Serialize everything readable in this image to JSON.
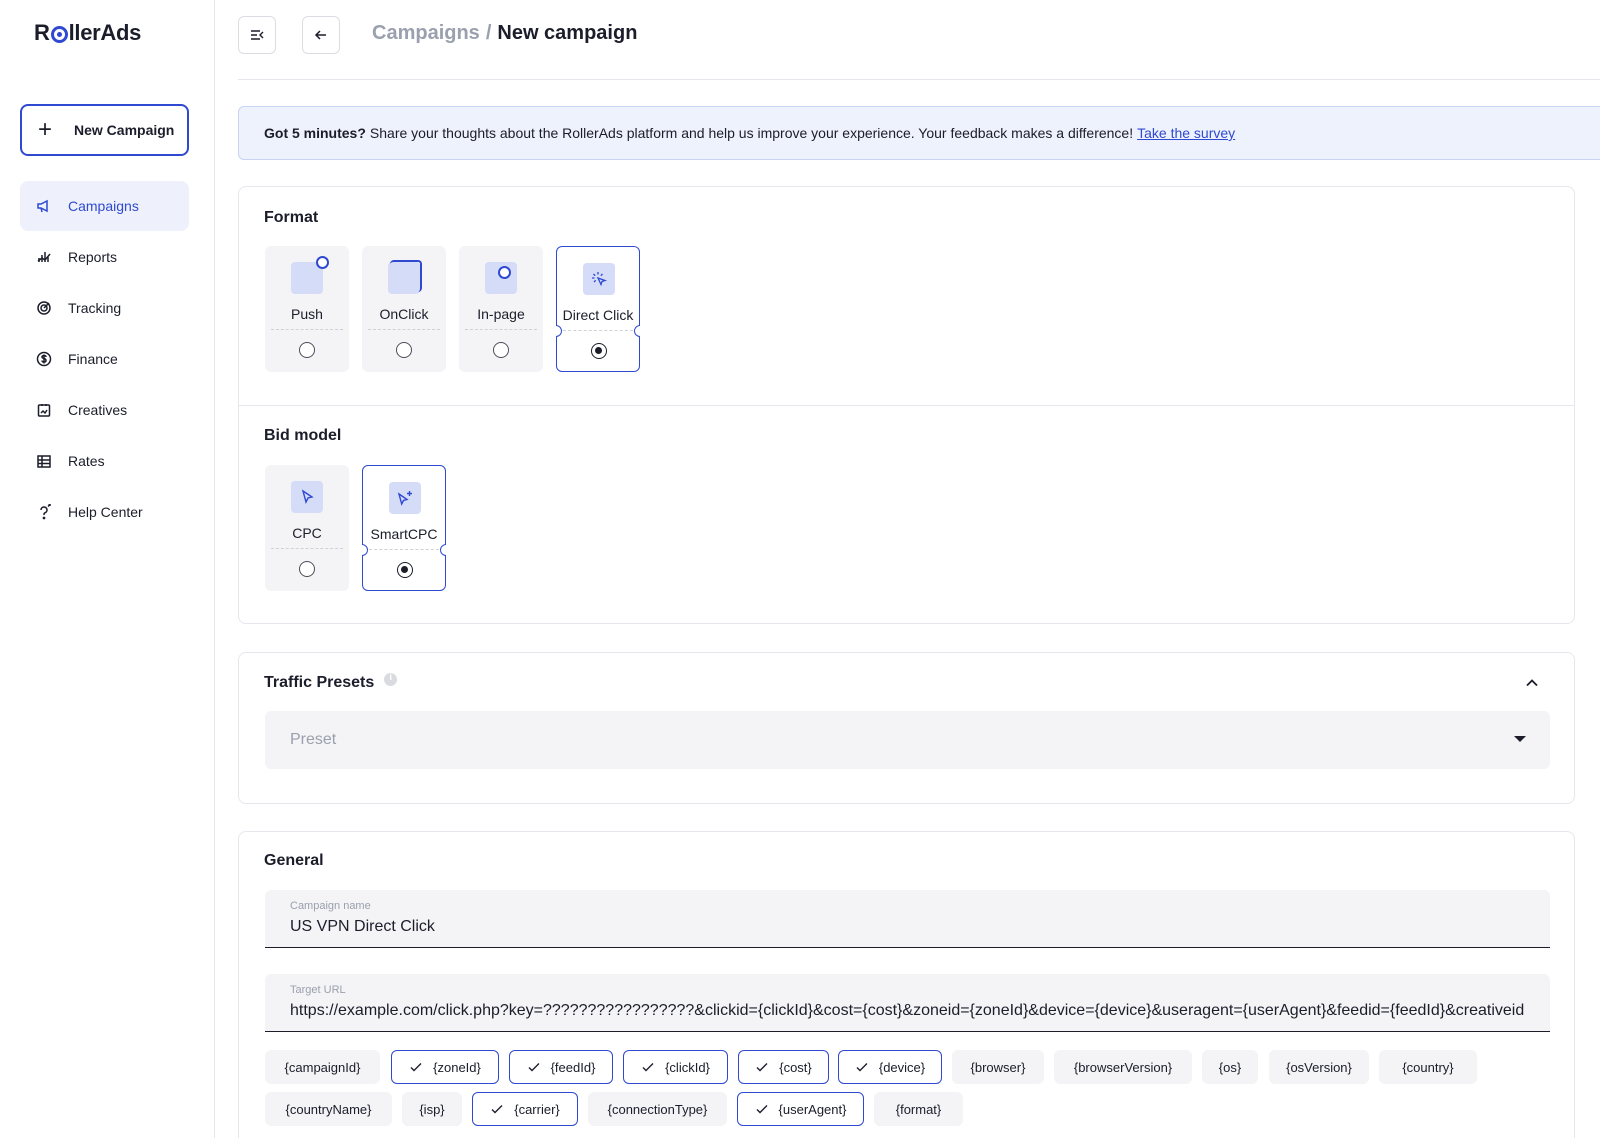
{
  "app": {
    "logo_text_before": "R",
    "logo_text_after": "llerAds",
    "accent_color": "#2f49d1"
  },
  "sidebar": {
    "new_campaign_label": "New Campaign",
    "items": [
      {
        "label": "Campaigns",
        "icon": "megaphone-icon",
        "active": true
      },
      {
        "label": "Reports",
        "icon": "chart-icon",
        "active": false
      },
      {
        "label": "Tracking",
        "icon": "target-icon",
        "active": false
      },
      {
        "label": "Finance",
        "icon": "dollar-icon",
        "active": false
      },
      {
        "label": "Creatives",
        "icon": "image-icon",
        "active": false
      },
      {
        "label": "Rates",
        "icon": "table-icon",
        "active": false
      },
      {
        "label": "Help Center",
        "icon": "help-icon",
        "active": false
      }
    ]
  },
  "header": {
    "breadcrumb_parent": "Campaigns",
    "breadcrumb_separator": "/",
    "breadcrumb_current": "New campaign"
  },
  "banner": {
    "bold": "Got 5 minutes?",
    "text": "Share your thoughts about the RollerAds platform and help us improve your experience. Your feedback makes a difference!",
    "link": "Take the survey"
  },
  "format": {
    "title": "Format",
    "options": [
      {
        "label": "Push",
        "selected": false
      },
      {
        "label": "OnClick",
        "selected": false
      },
      {
        "label": "In-page",
        "selected": false
      },
      {
        "label": "Direct Click",
        "selected": true
      }
    ]
  },
  "bid_model": {
    "title": "Bid model",
    "options": [
      {
        "label": "CPC",
        "selected": false
      },
      {
        "label": "SmartCPC",
        "selected": true
      }
    ]
  },
  "traffic_presets": {
    "title": "Traffic Presets",
    "placeholder": "Preset"
  },
  "general": {
    "title": "General",
    "campaign_name_label": "Campaign name",
    "campaign_name_value": "US VPN Direct Click",
    "target_url_label": "Target URL",
    "target_url_value": "https://example.com/click.php?key=?????????????????&clickid={clickId}&cost={cost}&zoneid={zoneId}&device={device}&useragent={userAgent}&feedid={feedId}&creativeid={",
    "macros": [
      {
        "label": "{campaignId}",
        "on": false
      },
      {
        "label": "{zoneId}",
        "on": true
      },
      {
        "label": "{feedId}",
        "on": true
      },
      {
        "label": "{clickId}",
        "on": true
      },
      {
        "label": "{cost}",
        "on": true
      },
      {
        "label": "{device}",
        "on": true
      },
      {
        "label": "{browser}",
        "on": false
      },
      {
        "label": "{browserVersion}",
        "on": false
      },
      {
        "label": "{os}",
        "on": false
      },
      {
        "label": "{osVersion}",
        "on": false
      },
      {
        "label": "{country}",
        "on": false
      },
      {
        "label": "{countryName}",
        "on": false
      },
      {
        "label": "{isp}",
        "on": false
      },
      {
        "label": "{carrier}",
        "on": true
      },
      {
        "label": "{connectionType}",
        "on": false
      },
      {
        "label": "{userAgent}",
        "on": true
      },
      {
        "label": "{format}",
        "on": false
      }
    ]
  }
}
